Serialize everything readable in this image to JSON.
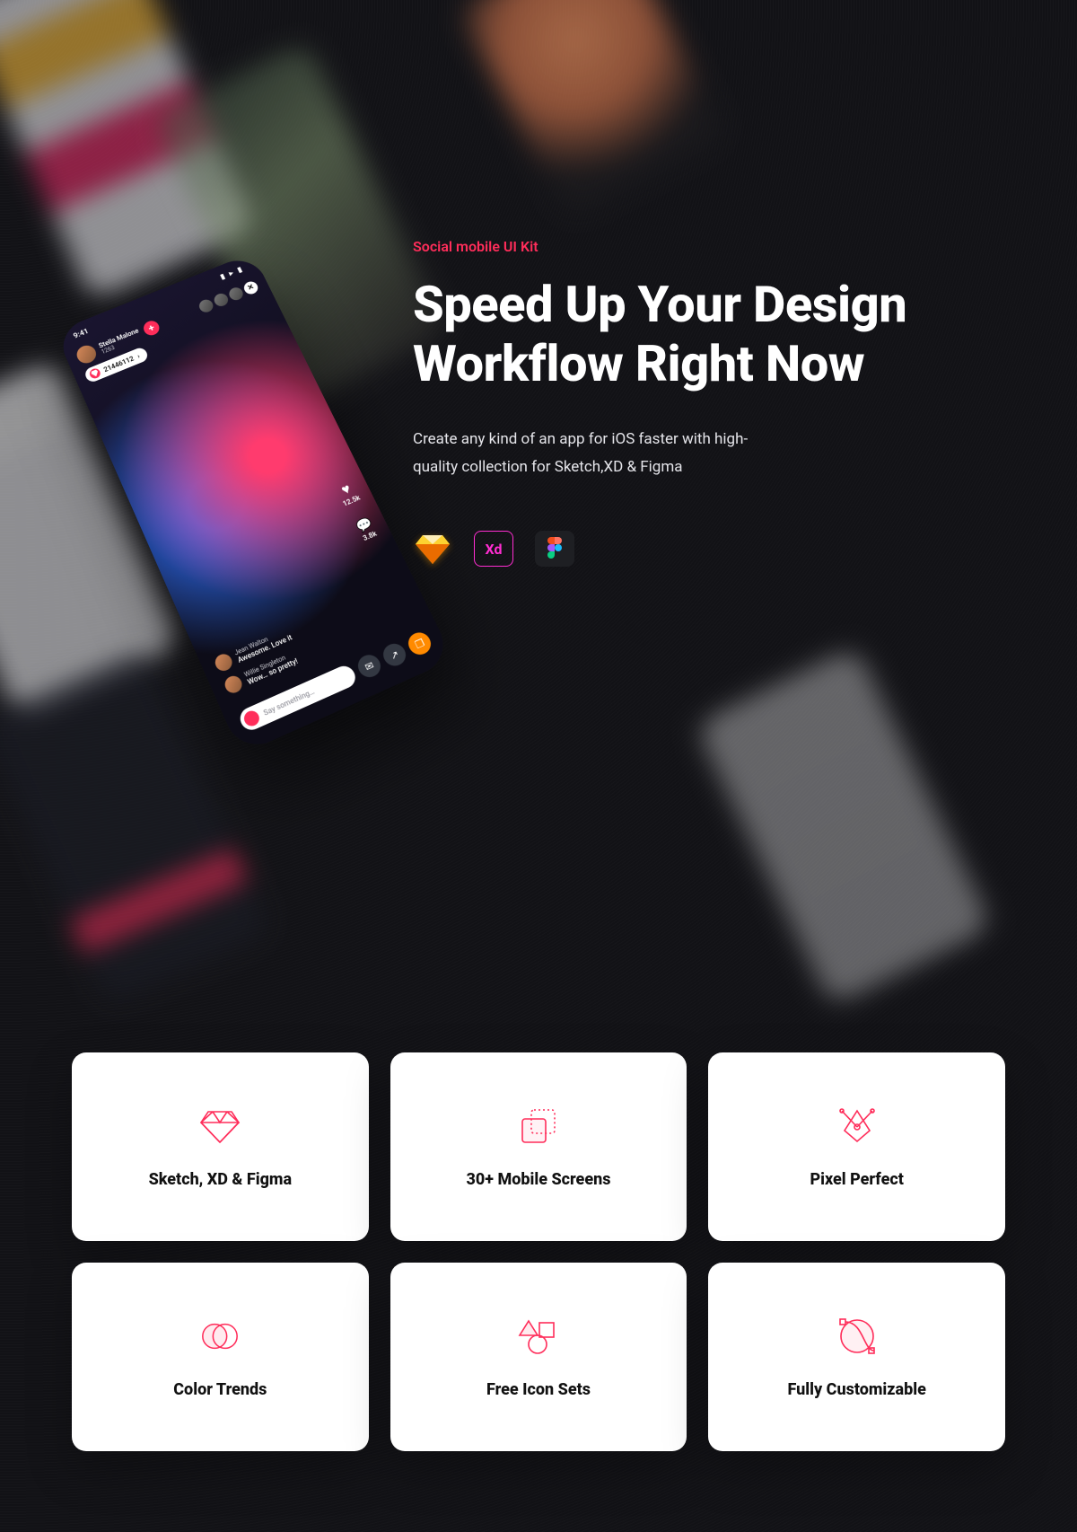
{
  "hero": {
    "kicker": "Social mobile UI Kit",
    "headline": "Speed Up Your Design Workflow Right Now",
    "description": "Create any kind of an app for iOS faster with high-quality collection for Sketch,XD & Figma"
  },
  "tools": {
    "sketch": "Sketch",
    "xd": "Xd",
    "figma": "Figma"
  },
  "phone": {
    "time": "9:41",
    "user_name": "Stella Malone",
    "user_count": "1263",
    "pill_value": "21446112",
    "like_count": "12.5k",
    "comment_count": "3.8k",
    "comments": [
      {
        "user": "Jean Walton",
        "msg": "Awesome. Love it"
      },
      {
        "user": "Willie Singleton",
        "msg": "Wow… so pretty!"
      }
    ],
    "input_placeholder": "Say something…"
  },
  "features": [
    {
      "icon": "diamond",
      "label": "Sketch, XD & Figma"
    },
    {
      "icon": "screens",
      "label": "30+ Mobile Screens"
    },
    {
      "icon": "pixel",
      "label": "Pixel Perfect"
    },
    {
      "icon": "color",
      "label": "Color Trends"
    },
    {
      "icon": "icons",
      "label": "Free Icon Sets"
    },
    {
      "icon": "custom",
      "label": "Fully Customizable"
    }
  ]
}
